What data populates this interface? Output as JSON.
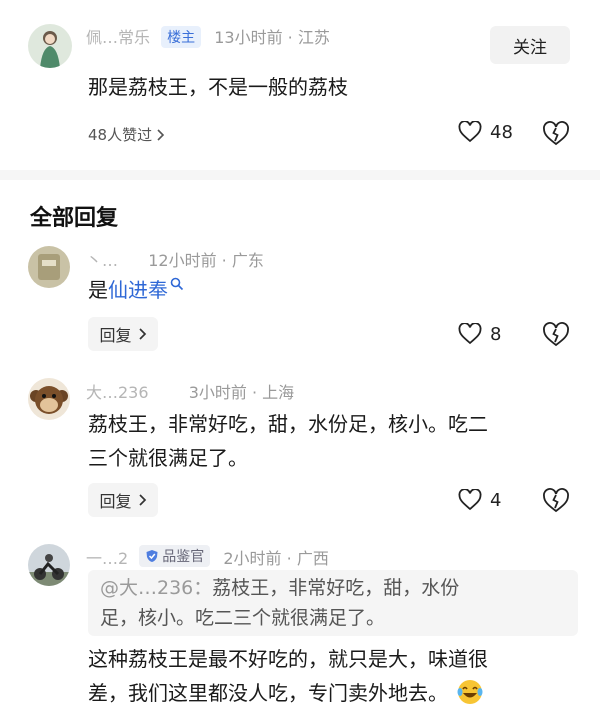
{
  "top_comment": {
    "username": "佩…常乐",
    "owner_badge": "楼主",
    "time_location": "13小时前 · 江苏",
    "follow_label": "关注",
    "text": "那是荔枝王，不是一般的荔枝",
    "likes_link": "48人赞过",
    "like_count": "48"
  },
  "section_title": "全部回复",
  "replies": [
    {
      "username": "丶…",
      "time_location": "12小时前 · 广东",
      "text_prefix": "是",
      "text_link": "仙进奉",
      "reply_label": "回复",
      "like_count": "8"
    },
    {
      "username": "大…236",
      "time_location": "3小时前 · 上海",
      "text_line1": "荔枝王，非常好吃，甜，水份足，核小。吃二",
      "text_line2": "三个就很满足了。",
      "reply_label": "回复",
      "like_count": "4"
    },
    {
      "username": "一…2",
      "judge_badge": "品鉴官",
      "time_location": "2小时前 · 广西",
      "quote_name": "@大…236：",
      "quote_line1": "荔枝王，非常好吃，甜，水份",
      "quote_line2": "足，核小。吃二三个就很满足了。",
      "text_line1": "这种荔枝王是最不好吃的，就只是大，味道很",
      "text_line2": "差，我们这里都没人吃，专门卖外地去。"
    }
  ],
  "icons": {
    "like": "heart-outline-icon",
    "dislike": "broken-heart-icon",
    "chevron": "chevron-right-icon",
    "search_hint": "search-icon",
    "verified": "verified-shield-icon",
    "emoji": "laughing-tears-emoji"
  },
  "colors": {
    "link": "#2f68d6",
    "owner_badge_bg": "#e8f0fc",
    "owner_badge_text": "#3a6fd8",
    "meta_text": "#9a9a9a"
  }
}
